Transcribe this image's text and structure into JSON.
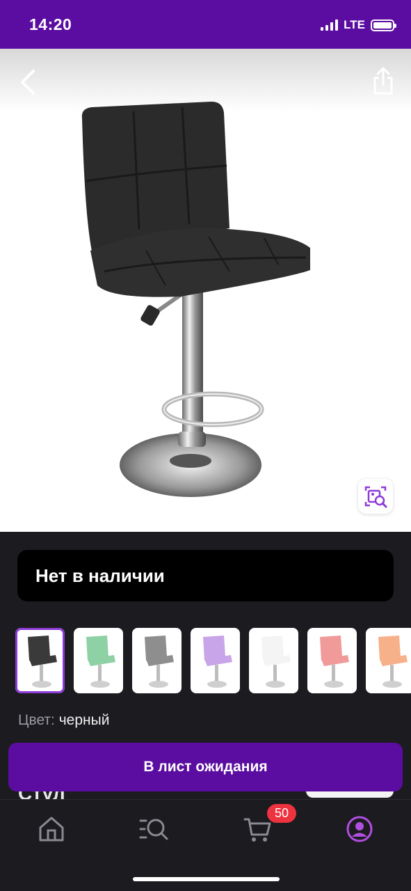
{
  "status_bar": {
    "time": "14:20",
    "network": "LTE"
  },
  "product": {
    "stock_status": "Нет в наличии",
    "color_label": "Цвет:",
    "color_value": "черный",
    "title_peek": "Стул",
    "swatches": [
      {
        "color": "#3a3a3a",
        "selected": true
      },
      {
        "color": "#8ed1a4",
        "selected": false
      },
      {
        "color": "#8e8e8e",
        "selected": false
      },
      {
        "color": "#c8a4e8",
        "selected": false
      },
      {
        "color": "#f4f4f4",
        "selected": false
      },
      {
        "color": "#f09a9a",
        "selected": false
      },
      {
        "color": "#f6b08a",
        "selected": false
      }
    ]
  },
  "actions": {
    "waitlist_label": "В лист ожидания"
  },
  "tabbar": {
    "cart_badge": "50",
    "items": [
      "home-icon",
      "catalog-search-icon",
      "cart-icon",
      "profile-icon"
    ],
    "active_color": "#b04fe0",
    "inactive_color": "#8a8a90"
  },
  "colors": {
    "brand": "#5a0da0",
    "badge": "#ee3340"
  }
}
